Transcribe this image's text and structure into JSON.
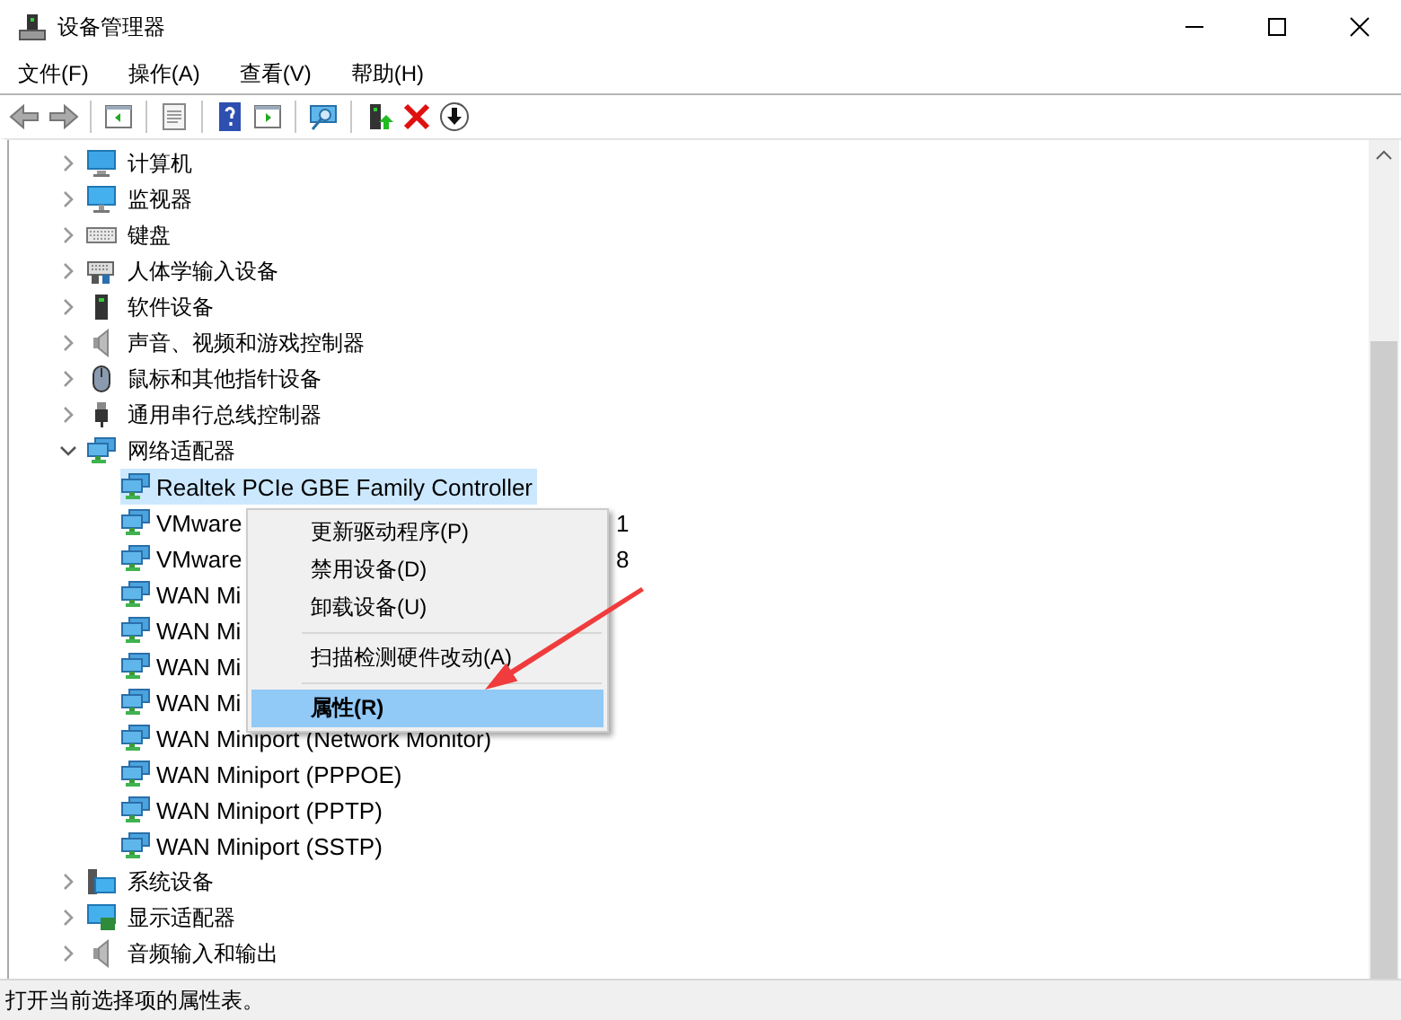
{
  "window": {
    "title": "设备管理器"
  },
  "menu_bar": [
    "文件(F)",
    "操作(A)",
    "查看(V)",
    "帮助(H)"
  ],
  "tree": [
    {
      "label": "计算机",
      "kind": "computer",
      "expanded": false
    },
    {
      "label": "监视器",
      "kind": "monitor",
      "expanded": false
    },
    {
      "label": "键盘",
      "kind": "keyboard",
      "expanded": false
    },
    {
      "label": "人体学输入设备",
      "kind": "hid",
      "expanded": false
    },
    {
      "label": "软件设备",
      "kind": "software",
      "expanded": false
    },
    {
      "label": "声音、视频和游戏控制器",
      "kind": "sound",
      "expanded": false
    },
    {
      "label": "鼠标和其他指针设备",
      "kind": "mouse",
      "expanded": false
    },
    {
      "label": "通用串行总线控制器",
      "kind": "usb",
      "expanded": false
    },
    {
      "label": "网络适配器",
      "kind": "network",
      "expanded": true,
      "children": [
        {
          "label": "Realtek PCIe GBE Family Controller",
          "selected": true
        },
        {
          "label": "VMware",
          "tail": "1",
          "selected": false
        },
        {
          "label": "VMware",
          "tail": "8",
          "selected": false
        },
        {
          "label": "WAN Mi",
          "selected": false
        },
        {
          "label": "WAN Mi",
          "selected": false
        },
        {
          "label": "WAN Mi",
          "selected": false
        },
        {
          "label": "WAN Mi",
          "selected": false
        },
        {
          "label": "WAN Miniport (Network Monitor)",
          "selected": false
        },
        {
          "label": "WAN Miniport (PPPOE)",
          "selected": false
        },
        {
          "label": "WAN Miniport (PPTP)",
          "selected": false
        },
        {
          "label": "WAN Miniport (SSTP)",
          "selected": false
        }
      ]
    },
    {
      "label": "系统设备",
      "kind": "system",
      "expanded": false
    },
    {
      "label": "显示适配器",
      "kind": "display",
      "expanded": false
    },
    {
      "label": "音频输入和输出",
      "kind": "sound",
      "expanded": false
    }
  ],
  "context_menu": [
    {
      "kind": "item",
      "label": "更新驱动程序(P)",
      "selected": false,
      "default": false
    },
    {
      "kind": "item",
      "label": "禁用设备(D)",
      "selected": false,
      "default": false
    },
    {
      "kind": "item",
      "label": "卸载设备(U)",
      "selected": false,
      "default": false
    },
    {
      "kind": "separator"
    },
    {
      "kind": "item",
      "label": "扫描检测硬件改动(A)",
      "selected": false,
      "default": false
    },
    {
      "kind": "separator"
    },
    {
      "kind": "item",
      "label": "属性(R)",
      "selected": true,
      "default": true
    }
  ],
  "status_bar": "打开当前选择项的属性表。"
}
